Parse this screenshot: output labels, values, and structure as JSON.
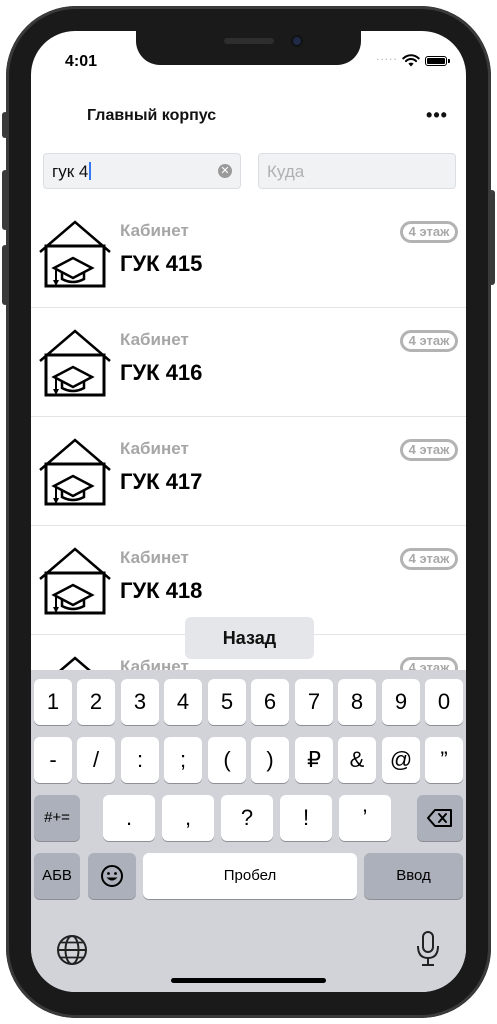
{
  "status_bar": {
    "time": "4:01",
    "signal_dots": "....."
  },
  "nav": {
    "title": "Главный корпус",
    "more_label": "•••"
  },
  "search": {
    "from_value": "гук 4",
    "clear_glyph": "✕",
    "to_placeholder": "Куда"
  },
  "results": [
    {
      "type": "Кабинет",
      "name": "ГУК 415",
      "floor": "4 этаж"
    },
    {
      "type": "Кабинет",
      "name": "ГУК 416",
      "floor": "4 этаж"
    },
    {
      "type": "Кабинет",
      "name": "ГУК 417",
      "floor": "4 этаж"
    },
    {
      "type": "Кабинет",
      "name": "ГУК 418",
      "floor": "4 этаж"
    },
    {
      "type": "Кабинет",
      "name": "",
      "floor": "4 этаж"
    }
  ],
  "back_button": "Назад",
  "keyboard": {
    "row1": [
      "1",
      "2",
      "3",
      "4",
      "5",
      "6",
      "7",
      "8",
      "9",
      "0"
    ],
    "row2": [
      "-",
      "/",
      ":",
      ";",
      "(",
      ")",
      "₽",
      "&",
      "@",
      "”"
    ],
    "row3": [
      ".",
      ",",
      "?",
      "!",
      "’"
    ],
    "symbols_key": "#+=",
    "backspace_icon": "backspace-icon",
    "alpha_key": "АБВ",
    "emoji_icon": "emoji-icon",
    "space_key": "Пробел",
    "return_key": "Ввод",
    "globe_icon": "globe-icon",
    "mic_icon": "microphone-icon"
  },
  "colors": {
    "caret": "#3478f6",
    "keyboard_bg": "#d1d3d9",
    "badge_border": "#b3b3b3",
    "muted_text": "#a6a6a6"
  }
}
